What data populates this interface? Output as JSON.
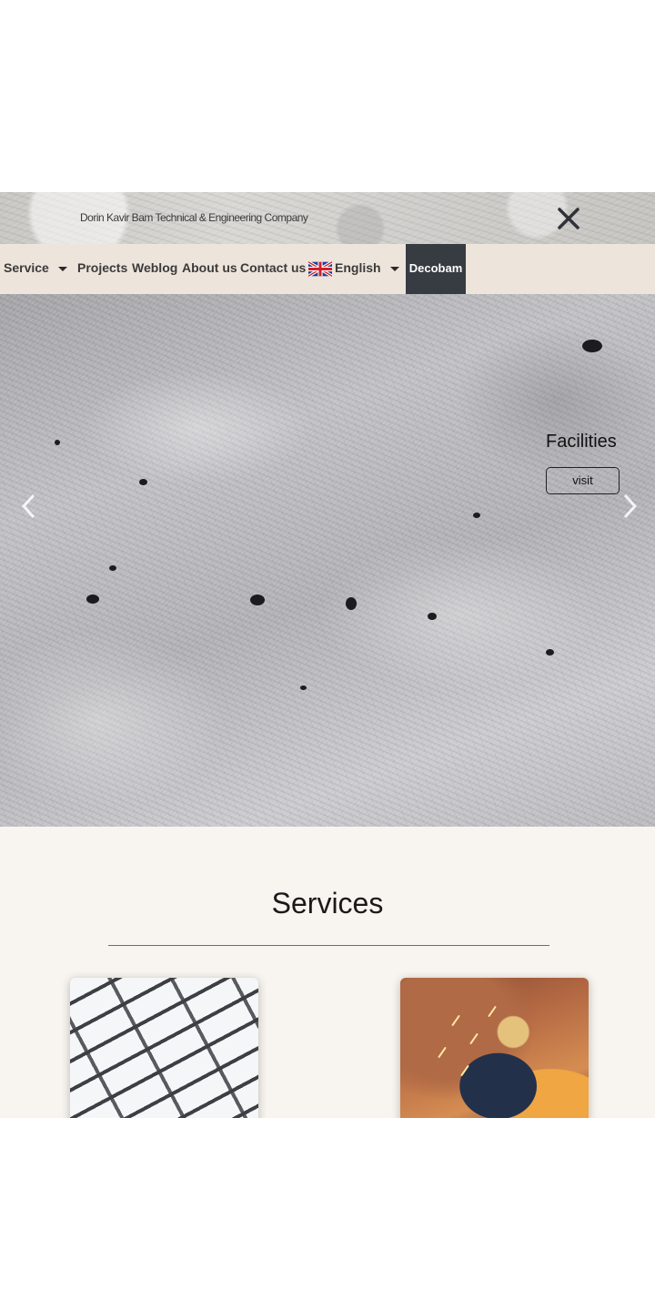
{
  "header": {
    "company_name": "Dorin Kavir Bam Technical & Engineering Company",
    "close_icon": "close-icon"
  },
  "nav": {
    "items": [
      {
        "label": "Service",
        "has_dropdown": true
      },
      {
        "label": "Projects"
      },
      {
        "label": "Weblog"
      },
      {
        "label": "About us"
      },
      {
        "label": "Contact us"
      }
    ],
    "language": {
      "label": "English",
      "flag_icon": "uk-flag-icon",
      "has_dropdown": true
    },
    "brand_button": "Decobam",
    "colors": {
      "background": "#ede4db",
      "brand_button_bg": "#373b42"
    }
  },
  "hero": {
    "caption": "Facilities",
    "button_label": "visit",
    "prev_icon": "chevron-left-icon",
    "next_icon": "chevron-right-icon"
  },
  "services": {
    "title": "Services",
    "cards": [
      {
        "image": "white-brick-wall-image"
      },
      {
        "image": "grinding-worker-image"
      }
    ],
    "colors": {
      "background": "#f8f4ef"
    }
  }
}
